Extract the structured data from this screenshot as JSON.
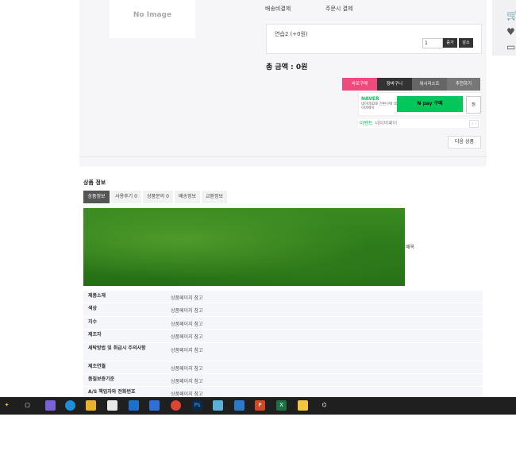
{
  "product": {
    "no_image": "No Image",
    "shipping_label": "배송비결제",
    "shipping_value": "주문시 결제",
    "option_name": "연습2 (+0원)",
    "qty_value": "1",
    "qty_up": "증가",
    "qty_down": "감소",
    "total_label": "총 금액 : 0원"
  },
  "actions": {
    "buy": "바로구매",
    "cart": "장바구니",
    "wish": "위시리스트",
    "recommend": "추천하기",
    "next_product": "다음 상품"
  },
  "naver": {
    "logo": "NAVER",
    "desc": "네이버ID로 간편구매 네이버페이",
    "pay_button": "N pay 구매",
    "side_button": "찜",
    "event_label": "이벤트",
    "event_desc": "네이버페이",
    "arrows": "‹ ›"
  },
  "detail": {
    "title": "상품 정보",
    "tabs": [
      "상품정보",
      "사용후기 0",
      "상품문의 0",
      "배송정보",
      "교환정보"
    ],
    "caption": "배옥",
    "spec": [
      {
        "k": "제품소재",
        "v": "상품페이지 참고"
      },
      {
        "k": "색상",
        "v": "상품페이지 참고"
      },
      {
        "k": "치수",
        "v": "상품페이지 참고"
      },
      {
        "k": "제조자",
        "v": "상품페이지 참고"
      },
      {
        "k": "세탁방법 및 취급시 주의사항",
        "v": "상품페이지 참고"
      },
      {
        "k": "제조연월",
        "v": "상품페이지 참고"
      },
      {
        "k": "품질보증기준",
        "v": "상품페이지 참고"
      },
      {
        "k": "A/S 책임자와 전화번호",
        "v": "상품페이지 참고"
      }
    ]
  },
  "colors": {
    "buy": "#f0497d",
    "cart": "#333333",
    "wish": "#666666",
    "recommend": "#777777",
    "naver_green": "#03c75a"
  },
  "taskbar": {
    "icons": [
      "widgets-icon",
      "task-view-icon",
      "copilot-icon",
      "edge-icon",
      "explorer-icon",
      "calendar-icon",
      "outlook-icon",
      "app-icon",
      "chrome-icon",
      "photoshop-icon",
      "paint-icon",
      "app2-icon",
      "powerpoint-icon",
      "excel-icon",
      "sticky-notes-icon",
      "chatgpt-icon"
    ]
  }
}
